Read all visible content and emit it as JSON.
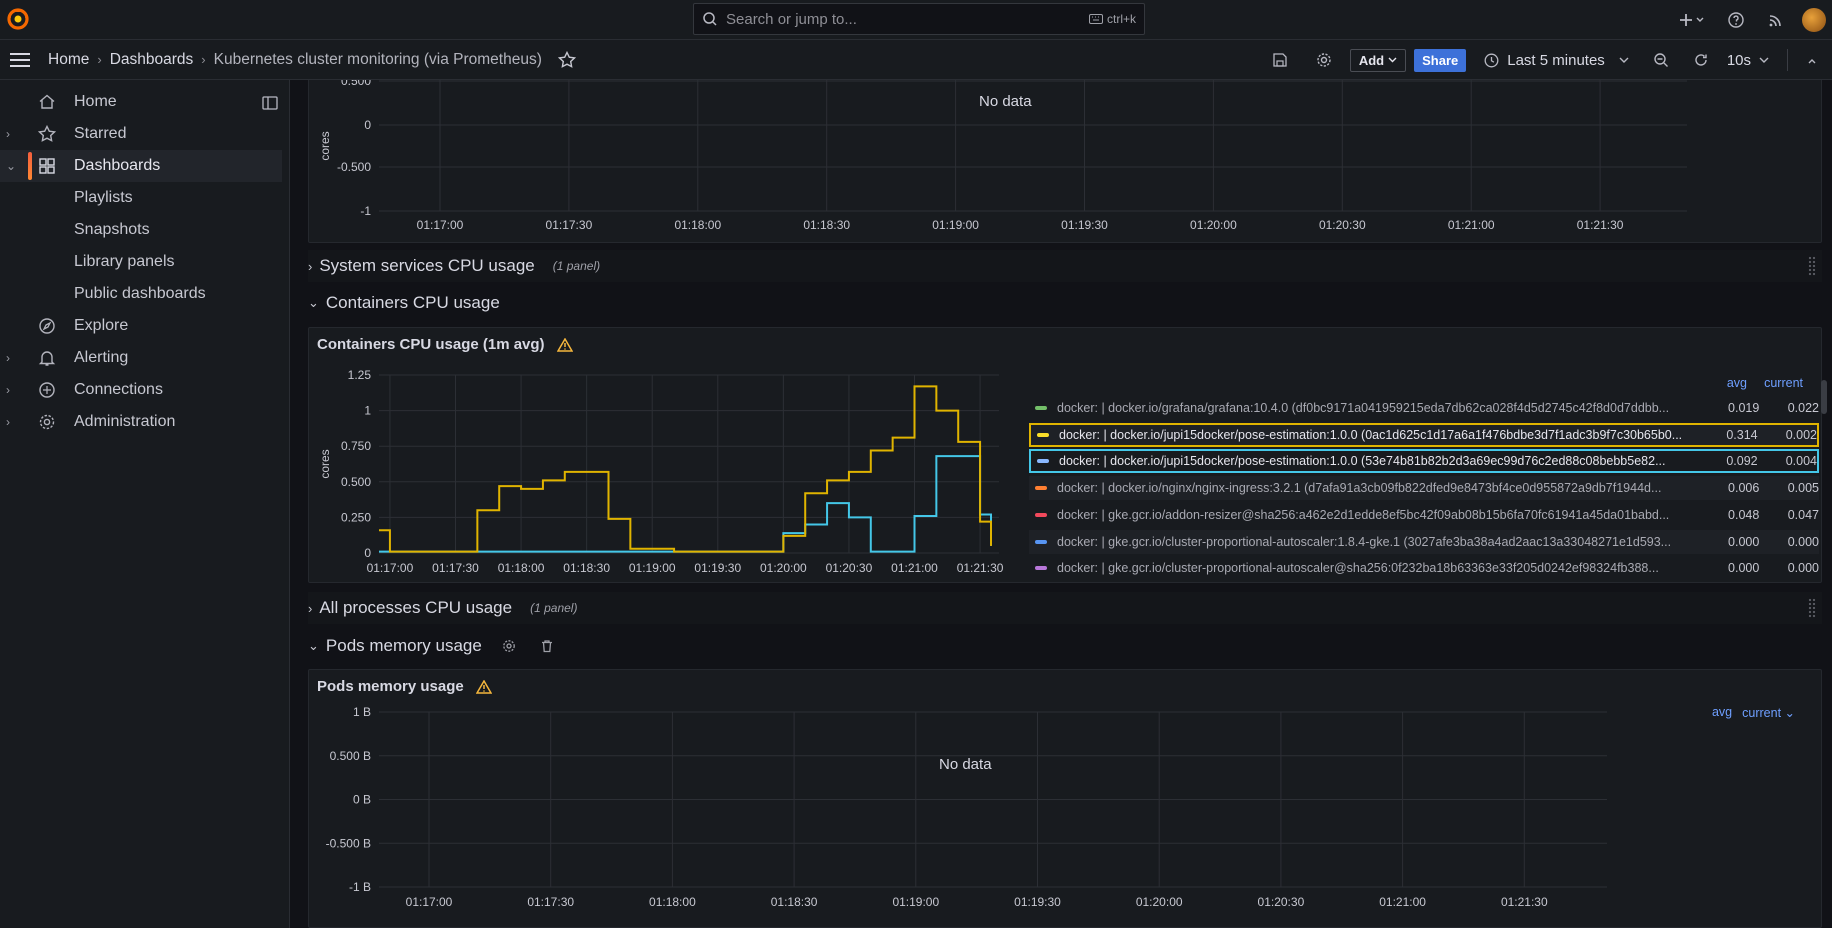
{
  "topbar": {
    "search_placeholder": "Search or jump to...",
    "search_shortcut": "ctrl+k"
  },
  "navbar": {
    "breadcrumbs": [
      "Home",
      "Dashboards",
      "Kubernetes cluster monitoring (via Prometheus)"
    ],
    "add_label": "Add",
    "share_label": "Share",
    "time_range": "Last 5 minutes",
    "refresh_interval": "10s"
  },
  "sidebar": {
    "items": [
      {
        "label": "Home",
        "icon": "home-icon"
      },
      {
        "label": "Starred",
        "icon": "star-icon"
      },
      {
        "label": "Dashboards",
        "icon": "dashboards-icon"
      },
      {
        "label": "Playlists"
      },
      {
        "label": "Snapshots"
      },
      {
        "label": "Library panels"
      },
      {
        "label": "Public dashboards"
      },
      {
        "label": "Explore",
        "icon": "explore-icon"
      },
      {
        "label": "Alerting",
        "icon": "bell-icon"
      },
      {
        "label": "Connections",
        "icon": "connections-icon"
      },
      {
        "label": "Administration",
        "icon": "gear-icon"
      }
    ]
  },
  "panel_top": {
    "no_data": "No data",
    "ylabel": "cores",
    "yticks": [
      "0.500",
      "0",
      "-0.500",
      "-1"
    ],
    "xticks": [
      "01:17:00",
      "01:17:30",
      "01:18:00",
      "01:18:30",
      "01:19:00",
      "01:19:30",
      "01:20:00",
      "01:20:30",
      "01:21:00",
      "01:21:30"
    ]
  },
  "rows": {
    "system_services": {
      "title": "System services CPU usage",
      "count": "(1 panel)"
    },
    "containers": {
      "title": "Containers CPU usage"
    },
    "all_processes": {
      "title": "All processes CPU usage",
      "count": "(1 panel)"
    },
    "pods_memory": {
      "title": "Pods memory usage"
    }
  },
  "containers_panel": {
    "title": "Containers CPU usage (1m avg)",
    "legend_avg": "avg",
    "legend_current": "current",
    "legend": [
      {
        "name": "docker: | docker.io/grafana/grafana:10.4.0 (df0bc9171a041959215eda7db62ca028f4d5d2745c42f8d0d7ddbb...",
        "avg": "0.019",
        "current": "0.022",
        "color": "#73bf69"
      },
      {
        "name": "docker: | docker.io/jupi15docker/pose-estimation:1.0.0 (0ac1d625c1d17a6a1f476bdbe3d7f1adc3b9f7c30b65b0...",
        "avg": "0.314",
        "current": "0.002",
        "color": "#fade2a"
      },
      {
        "name": "docker: | docker.io/jupi15docker/pose-estimation:1.0.0 (53e74b81b82b2d3a69ec99d76c2ed88c08bebb5e82...",
        "avg": "0.092",
        "current": "0.004",
        "color": "#8ab8ff"
      },
      {
        "name": "docker: | docker.io/nginx/nginx-ingress:3.2.1 (d7afa91a3cb09fb822dfed9e8473bf4ce0d955872a9db7f1944d...",
        "avg": "0.006",
        "current": "0.005",
        "color": "#ff7f32"
      },
      {
        "name": "docker: | gke.gcr.io/addon-resizer@sha256:a462e2d1edde8ef5bc42f09ab08b15b6fa70fc61941a45da01babd...",
        "avg": "0.048",
        "current": "0.047",
        "color": "#f2495c"
      },
      {
        "name": "docker: | gke.gcr.io/cluster-proportional-autoscaler:1.8.4-gke.1 (3027afe3ba38a4ad2aac13a33048271e1d593...",
        "avg": "0.000",
        "current": "0.000",
        "color": "#5794f2"
      },
      {
        "name": "docker: | gke.gcr.io/cluster-proportional-autoscaler@sha256:0f232ba18b63363e33f205d0242ef98324fb388...",
        "avg": "0.000",
        "current": "0.000",
        "color": "#b877d9"
      }
    ]
  },
  "chart_data": [
    {
      "type": "line",
      "title": "Containers CPU usage (1m avg)",
      "ylabel": "cores",
      "ylim": [
        0,
        1.25
      ],
      "yticks": [
        "0",
        "0.250",
        "0.500",
        "0.750",
        "1",
        "1.25"
      ],
      "xticks": [
        "01:17:00",
        "01:17:30",
        "01:18:00",
        "01:18:30",
        "01:19:00",
        "01:19:30",
        "01:20:00",
        "01:20:30",
        "01:21:00",
        "01:21:30"
      ],
      "x": [
        "01:16:55",
        "01:17:00",
        "01:17:10",
        "01:17:20",
        "01:17:30",
        "01:17:40",
        "01:17:50",
        "01:18:00",
        "01:18:10",
        "01:18:20",
        "01:18:30",
        "01:18:40",
        "01:18:50",
        "01:19:00",
        "01:19:10",
        "01:19:20",
        "01:19:30",
        "01:19:40",
        "01:19:50",
        "01:20:00",
        "01:20:10",
        "01:20:20",
        "01:20:30",
        "01:20:40",
        "01:20:50",
        "01:21:00",
        "01:21:10",
        "01:21:20",
        "01:21:30",
        "01:21:35"
      ],
      "series": [
        {
          "name": "docker: | docker.io/jupi15docker/pose-estimation:1.0.0 (0ac1d625c1d17a6a1f476bdbe3d7f1adc3b9f7c30b65b0...",
          "values": [
            0.16,
            0.01,
            0.01,
            0.01,
            0.01,
            0.3,
            0.47,
            0.45,
            0.51,
            0.57,
            0.57,
            0.24,
            0.03,
            0.03,
            0.01,
            0.01,
            0.01,
            0.01,
            0.01,
            0.12,
            0.42,
            0.51,
            0.57,
            0.72,
            0.81,
            1.17,
            1.0,
            0.78,
            0.22,
            0.05
          ]
        },
        {
          "name": "docker: | docker.io/jupi15docker/pose-estimation:1.0.0 (53e74b81b82b2d3a69ec99d76c2ed88c08bebb5e82...",
          "values": [
            0.01,
            0.01,
            0.01,
            0.01,
            0.01,
            0.01,
            0.01,
            0.01,
            0.01,
            0.01,
            0.01,
            0.01,
            0.01,
            0.01,
            0.01,
            0.01,
            0.01,
            0.01,
            0.01,
            0.14,
            0.2,
            0.35,
            0.25,
            0.01,
            0.01,
            0.26,
            0.68,
            0.68,
            0.27,
            0.05
          ]
        }
      ]
    }
  ],
  "pods_panel": {
    "title": "Pods memory usage",
    "no_data": "No data",
    "legend_avg": "avg",
    "legend_current": "current",
    "yticks": [
      "1 B",
      "0.500 B",
      "0 B",
      "-0.500 B",
      "-1 B"
    ],
    "xticks": [
      "01:17:00",
      "01:17:30",
      "01:18:00",
      "01:18:30",
      "01:19:00",
      "01:19:30",
      "01:20:00",
      "01:20:30",
      "01:21:00",
      "01:21:30"
    ]
  },
  "colors": {
    "accent_yellow": "#e0b400",
    "accent_cyan": "#44c7e8",
    "share_blue": "#3d71d9",
    "warning": "#f5b73d"
  }
}
